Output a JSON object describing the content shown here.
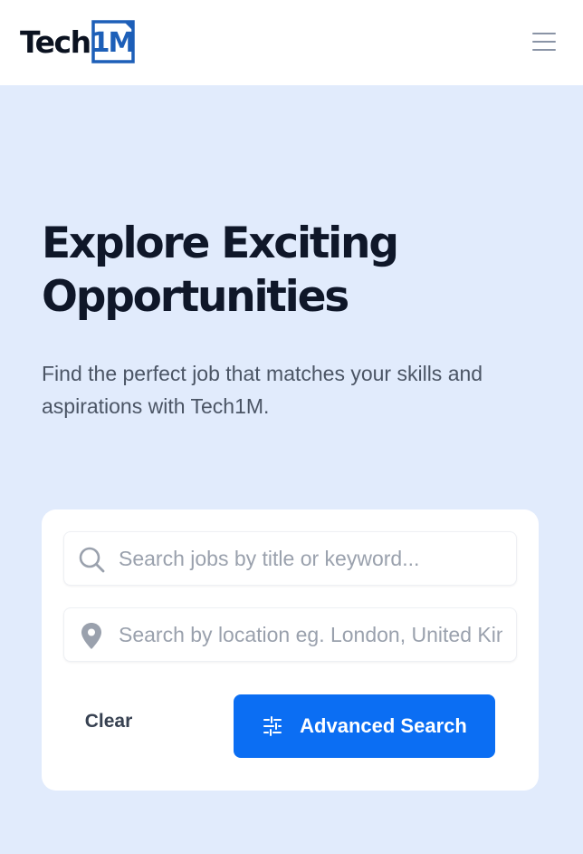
{
  "header": {
    "logo": {
      "wordmark": "Tech",
      "badge": "1M",
      "badge_color": "#1d5fb8"
    },
    "menu_icon": "hamburger-menu-icon"
  },
  "hero": {
    "title_line1": "Explore Exciting",
    "title_line2": "Opportunities",
    "subtitle": "Find the perfect job that matches your skills and aspirations with Tech1M.",
    "background": "#e1ebfc"
  },
  "search": {
    "keyword": {
      "placeholder": "Search jobs by title or keyword...",
      "value": "",
      "icon": "search-icon"
    },
    "location": {
      "placeholder": "Search by location eg. London, United Kingdom",
      "value": "",
      "icon": "map-pin-icon"
    },
    "clear_label": "Clear",
    "advanced_label": "Advanced Search",
    "advanced_icon": "sliders-icon",
    "accent": "#0b6ef3"
  }
}
